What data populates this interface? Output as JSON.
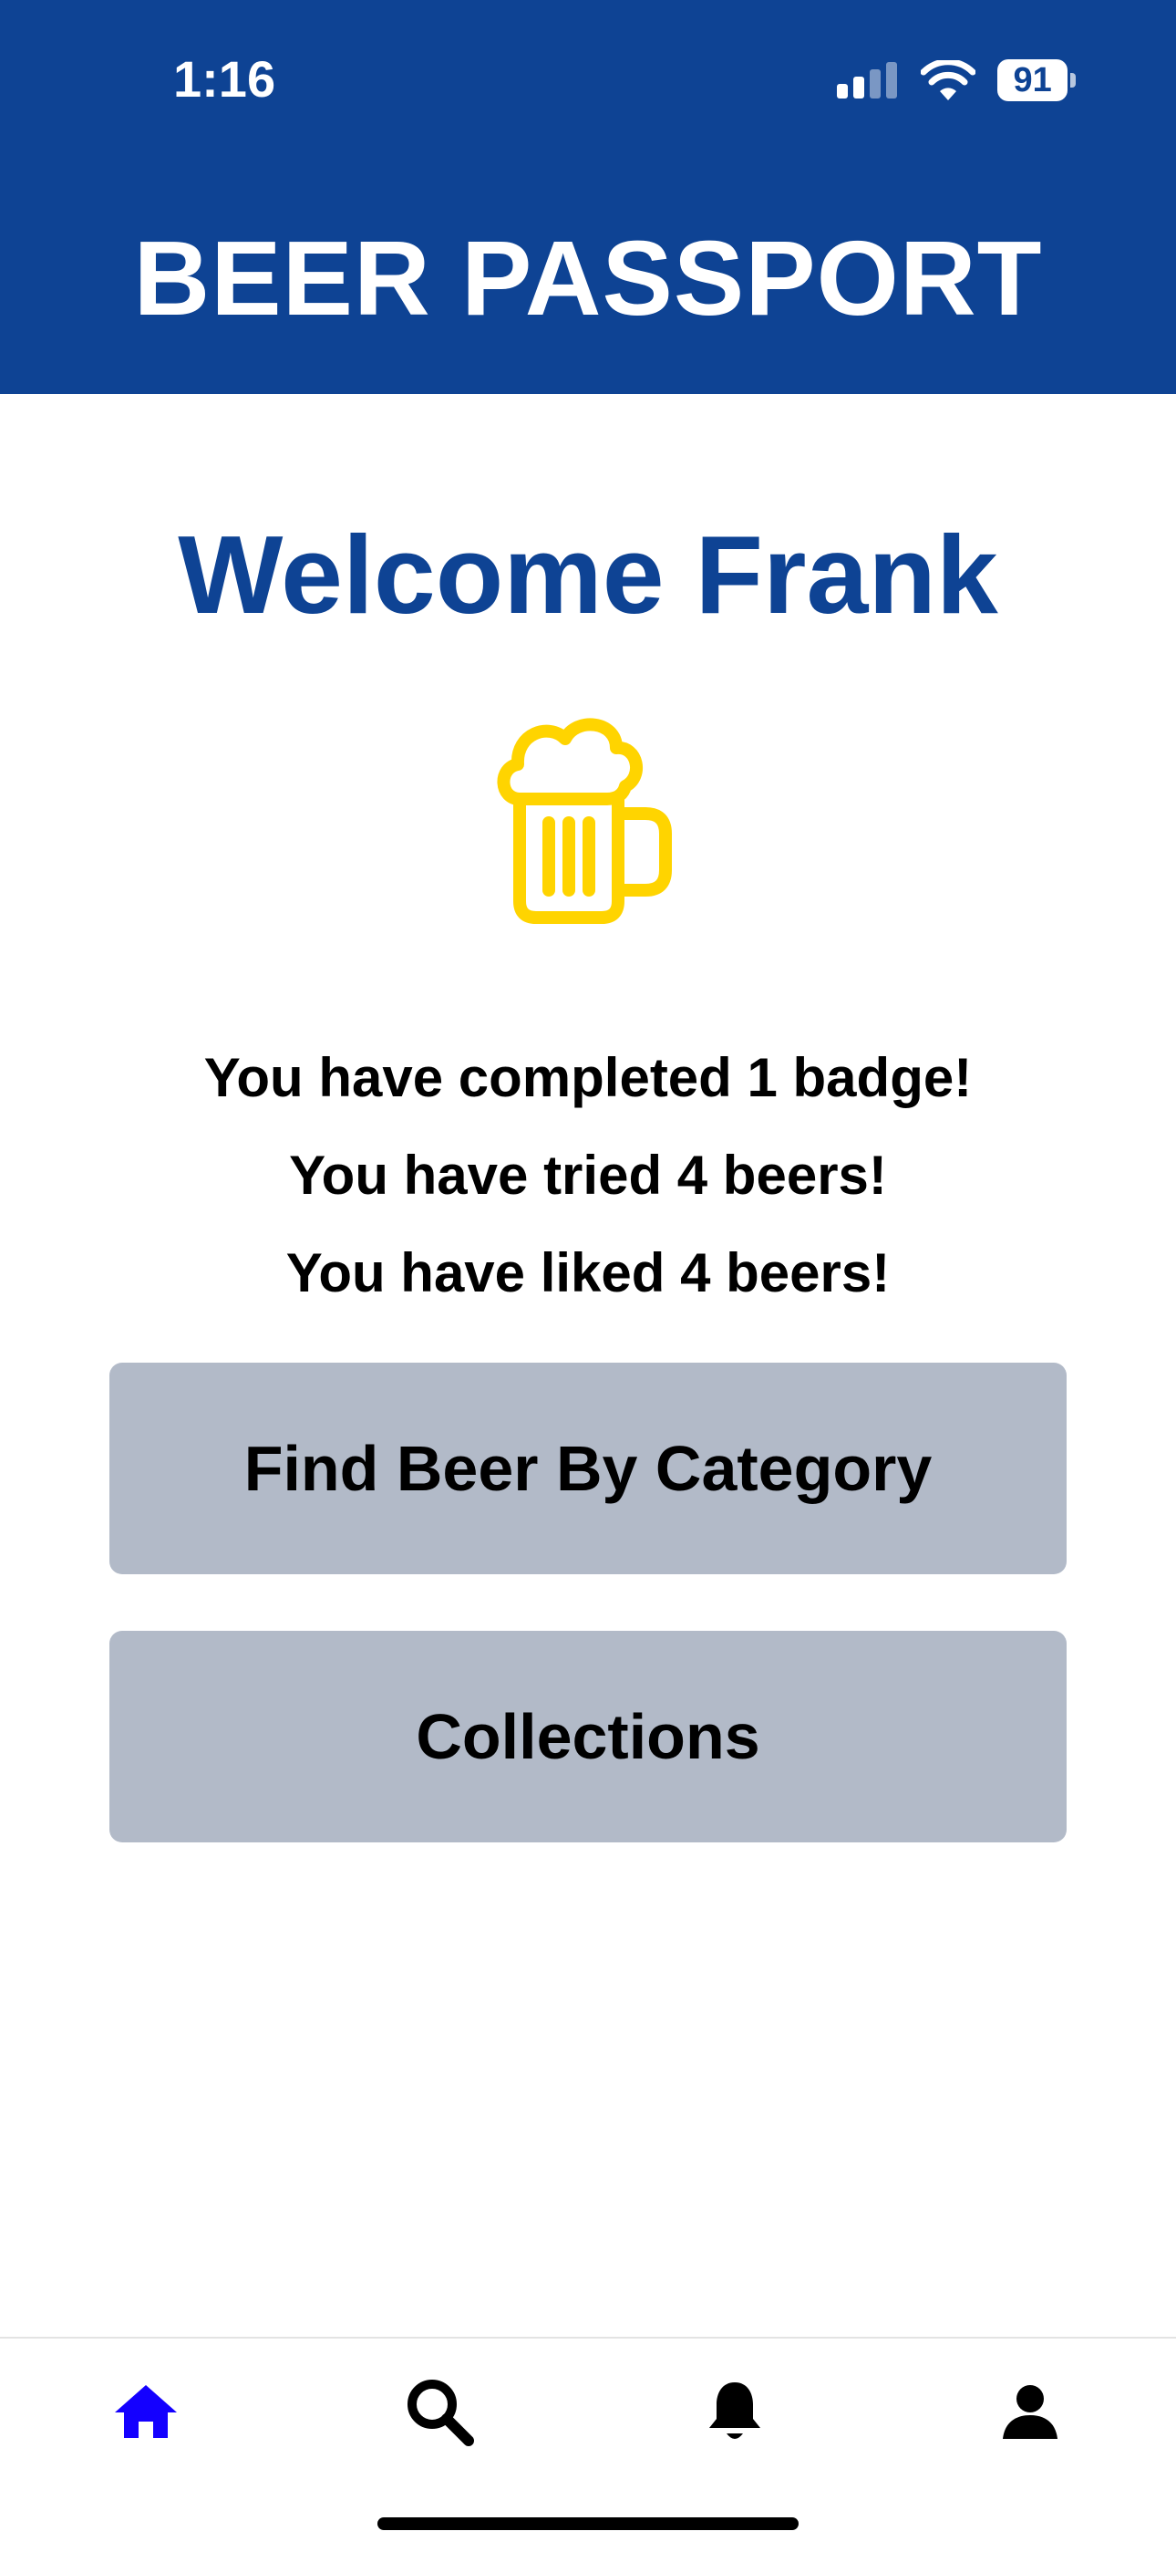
{
  "status_bar": {
    "time": "1:16",
    "battery": "91"
  },
  "header": {
    "title": "BEER PASSPORT"
  },
  "main": {
    "welcome": "Welcome Frank",
    "stats": [
      "You have completed 1 badge!",
      "You have tried 4 beers!",
      "You have liked 4 beers!"
    ],
    "buttons": {
      "find_label": "Find Beer By Category",
      "collections_label": "Collections"
    }
  },
  "tab_bar": {
    "active": "home"
  },
  "colors": {
    "brand_blue": "#0e4394",
    "beer_yellow": "#ffd400",
    "button_gray": "#b2bac8",
    "active_tab": "#1400ff"
  }
}
